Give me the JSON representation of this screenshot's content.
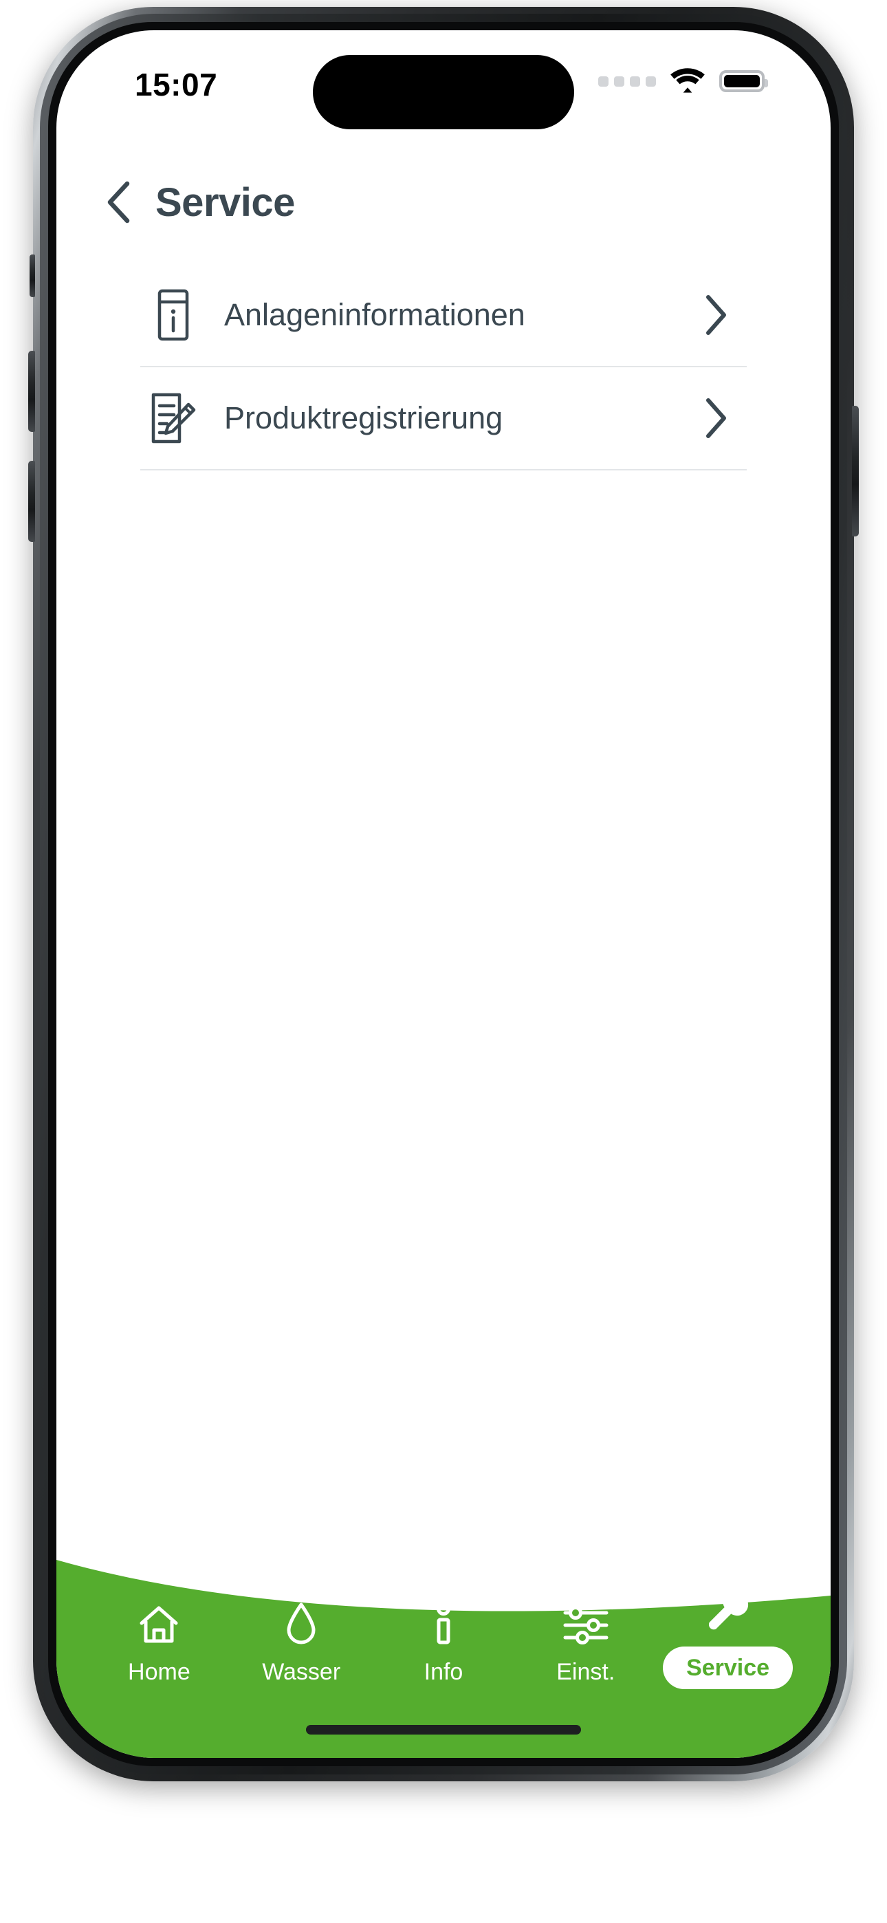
{
  "device": {
    "home_indicator": "home-indicator"
  },
  "status_bar": {
    "time": "15:07",
    "cellular_icon": "cellular-dots-icon",
    "cellular_dots": 4,
    "wifi_icon": "wifi-icon",
    "battery_icon": "battery-full-icon",
    "battery_level": 100
  },
  "header": {
    "back_icon": "chevron-left-icon",
    "title": "Service"
  },
  "list": {
    "items": [
      {
        "label": "Anlageninformationen",
        "icon": "device-info-icon",
        "chevron": "chevron-right-icon"
      },
      {
        "label": "Produktregistrierung",
        "icon": "document-pencil-icon",
        "chevron": "chevron-right-icon"
      }
    ]
  },
  "bottom_nav": {
    "background_color": "#55ad2e",
    "active_label_color": "#55ad2e",
    "items": [
      {
        "label": "Home",
        "icon": "house-icon",
        "active": false
      },
      {
        "label": "Wasser",
        "icon": "water-drop-icon",
        "active": false
      },
      {
        "label": "Info",
        "icon": "info-icon",
        "active": false
      },
      {
        "label": "Einst.",
        "icon": "sliders-icon",
        "active": false
      },
      {
        "label": "Service",
        "icon": "wrench-icon",
        "active": true
      }
    ]
  },
  "colors": {
    "text_dark": "#3b4851",
    "green": "#55ad2e",
    "divider": "#e3e6e8"
  }
}
